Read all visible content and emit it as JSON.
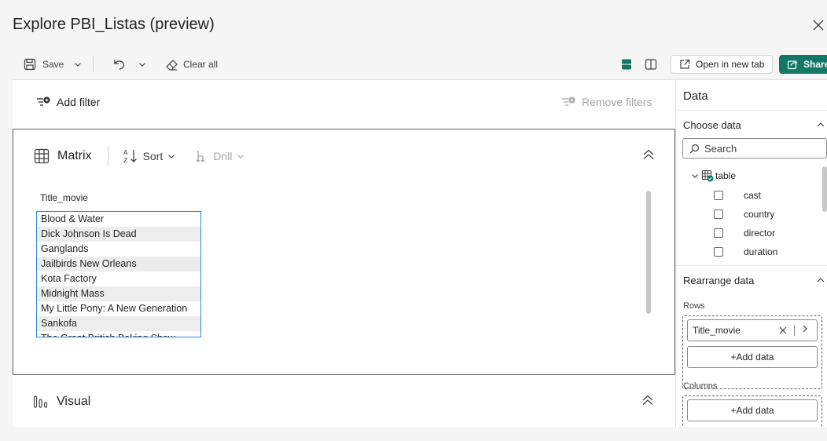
{
  "window": {
    "title": "Explore PBI_Listas (preview)"
  },
  "toolbar": {
    "save_label": "Save",
    "clear_all_label": "Clear all",
    "open_new_tab_label": "Open in new tab",
    "share_label": "Share"
  },
  "filters": {
    "add_filter_label": "Add filter",
    "remove_filters_label": "Remove filters"
  },
  "matrix": {
    "title": "Matrix",
    "sort_label": "Sort",
    "drill_label": "Drill",
    "column_header": "Title_movie",
    "rows": [
      "Blood & Water",
      "Dick Johnson Is Dead",
      "Ganglands",
      "Jailbirds New Orleans",
      "Kota Factory",
      "Midnight Mass",
      "My Little Pony: A New Generation",
      "Sankofa",
      "The Great British Baking Show"
    ]
  },
  "visual": {
    "title": "Visual"
  },
  "data_pane": {
    "title": "Data",
    "choose_data_title": "Choose data",
    "search_placeholder": "Search",
    "table_name": "table",
    "fields": [
      "cast",
      "country",
      "director",
      "duration"
    ],
    "rearrange_title": "Rearrange data",
    "rows_label": "Rows",
    "row_field": "Title_movie",
    "add_data_label": "+Add data",
    "columns_label": "Columns"
  },
  "colors": {
    "accent": "#117865",
    "selection": "#2b88d8"
  }
}
